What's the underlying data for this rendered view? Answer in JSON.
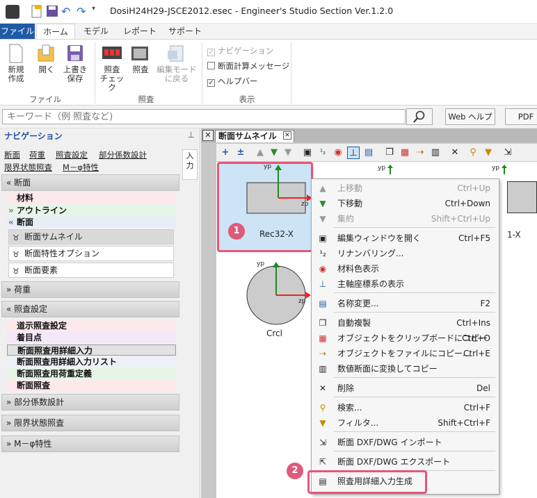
{
  "window": {
    "title": "DosiH24H29-JSCE2012.esec - Engineer's Studio Section Ver.1.2.0"
  },
  "ribbon_tabs": [
    "ファイル",
    "ホーム",
    "モデル",
    "レポート",
    "サポート"
  ],
  "ribbon": {
    "file_group": {
      "label": "ファイル",
      "new": "新規\n作成",
      "open": "開く",
      "save": "上書き\n保存"
    },
    "check_group": {
      "label": "照査",
      "check": "照査\nチェック",
      "verify": "照査",
      "back": "編集モード\nに戻る"
    },
    "view_group": {
      "label": "表示",
      "navigation": "ナビゲーション",
      "calc_message": "断面計算メッセージ",
      "helpbar": "ヘルプバー"
    }
  },
  "search": {
    "placeholder": "キーワード（例 照査など)",
    "web_help": "Web ヘルプ",
    "pdf": "PDF"
  },
  "nav": {
    "title": "ナビゲーション",
    "links": [
      "断面",
      "荷重",
      "照査設定",
      "部分係数設計",
      "限界状態照査",
      "M－φ特性"
    ],
    "side_tab": "入\n力",
    "sections": {
      "section": "断面",
      "load": "荷重",
      "check_settings": "照査設定",
      "partial": "部分係数設計",
      "limit": "限界状態照査",
      "mphi": "M－φ特性"
    },
    "section_items": {
      "material": "材料",
      "outline": "アウトライン",
      "section": "断面"
    },
    "section_subitems": [
      "断面サムネイル",
      "断面特性オプション",
      "断面要素"
    ],
    "check_items": [
      "道示照査設定",
      "着目点",
      "断面照査用詳細入力",
      "断面照査用詳細入力リスト",
      "断面照査用荷重定義",
      "断面照査"
    ]
  },
  "doc": {
    "tab_label": "断面サムネイル",
    "thumbs": [
      {
        "name": "Rec32-X",
        "yp": "yp",
        "zp": "zp"
      },
      {
        "name": "Crcl",
        "yp": "yp",
        "zp": "zp"
      },
      {
        "name": "1-X"
      }
    ],
    "top_labels": [
      "yp",
      "yp"
    ]
  },
  "context_menu": {
    "items": [
      {
        "label": "上移動",
        "shortcut": "Ctrl+Up",
        "disabled": true,
        "icon": "move-up-icon"
      },
      {
        "label": "下移動",
        "shortcut": "Ctrl+Down",
        "disabled": false,
        "icon": "move-down-icon"
      },
      {
        "label": "集約",
        "shortcut": "Shift+Ctrl+Up",
        "disabled": true,
        "icon": "aggregate-icon"
      },
      {
        "label": "編集ウィンドウを開く",
        "shortcut": "Ctrl+F5",
        "icon": "edit-window-icon"
      },
      {
        "label": "リナンバリング...",
        "shortcut": "",
        "icon": "renumber-icon"
      },
      {
        "label": "材料色表示",
        "shortcut": "",
        "icon": "material-color-icon"
      },
      {
        "label": "主軸座標系の表示",
        "shortcut": "",
        "icon": "principal-axis-icon"
      },
      {
        "label": "名称変更...",
        "shortcut": "F2",
        "icon": "rename-icon"
      },
      {
        "label": "自動複製",
        "shortcut": "Ctrl+Ins",
        "icon": "auto-copy-icon"
      },
      {
        "label": "オブジェクトをクリップボードにコピー",
        "shortcut": "Ctrl+O",
        "icon": "clipboard-icon"
      },
      {
        "label": "オブジェクトをファイルにコピー...",
        "shortcut": "Ctrl+E",
        "icon": "file-copy-icon"
      },
      {
        "label": "数値断面に変換してコピー",
        "shortcut": "",
        "icon": "numeric-section-icon"
      },
      {
        "label": "削除",
        "shortcut": "Del",
        "icon": "delete-icon"
      },
      {
        "label": "検索...",
        "shortcut": "Ctrl+F",
        "icon": "search-icon"
      },
      {
        "label": "フィルタ...",
        "shortcut": "Shift+Ctrl+F",
        "icon": "filter-icon"
      },
      {
        "label": "断面 DXF/DWG インポート",
        "shortcut": "",
        "icon": "dxf-import-icon"
      },
      {
        "label": "断面 DXF/DWG エクスポート",
        "shortcut": "",
        "icon": "dxf-export-icon"
      },
      {
        "label": "照査用詳細入力生成",
        "shortcut": "",
        "icon": "detail-input-icon"
      }
    ]
  },
  "callouts": [
    "1",
    "2"
  ],
  "colors": {
    "accent": "#1e5aa6",
    "highlight": "#e7557a",
    "selection": "#cde4f7"
  }
}
